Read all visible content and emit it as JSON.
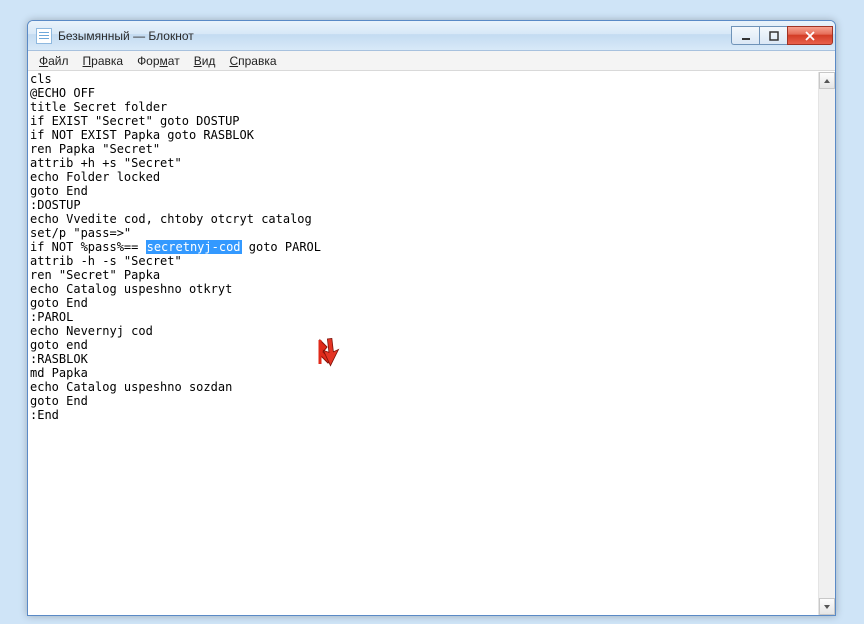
{
  "window": {
    "title": "Безымянный — Блокнот"
  },
  "menu": {
    "file": "Файл",
    "edit": "Правка",
    "format": "Формат",
    "view": "Вид",
    "help": "Справка"
  },
  "editor": {
    "lines_before": "cls\n@ECHO OFF\ntitle Secret folder\nif EXIST \"Secret\" goto DOSTUP\nif NOT EXIST Papka goto RASBLOK\nren Papka \"Secret\"\nattrib +h +s \"Secret\"\necho Folder locked\ngoto End\n:DOSTUP\necho Vvedite cod, chtoby otcryt catalog\nset/p \"pass=>\"",
    "line_sel_prefix": "if NOT %pass%== ",
    "line_sel_selected": "secretnyj-cod",
    "line_sel_suffix": " goto PAROL",
    "lines_after": "attrib -h -s \"Secret\"\nren \"Secret\" Papka\necho Catalog uspeshno otkryt\ngoto End\n:PAROL\necho Nevernyj cod\ngoto end\n:RASBLOK\nmd Papka\necho Catalog uspeshno sozdan\ngoto End\n:End"
  },
  "icons": {
    "minimize": "minimize-icon",
    "maximize": "maximize-icon",
    "close": "close-icon",
    "scroll_up": "chevron-up-icon",
    "scroll_down": "chevron-down-icon",
    "app": "notepad-icon",
    "cursor": "arrow-cursor-icon"
  }
}
